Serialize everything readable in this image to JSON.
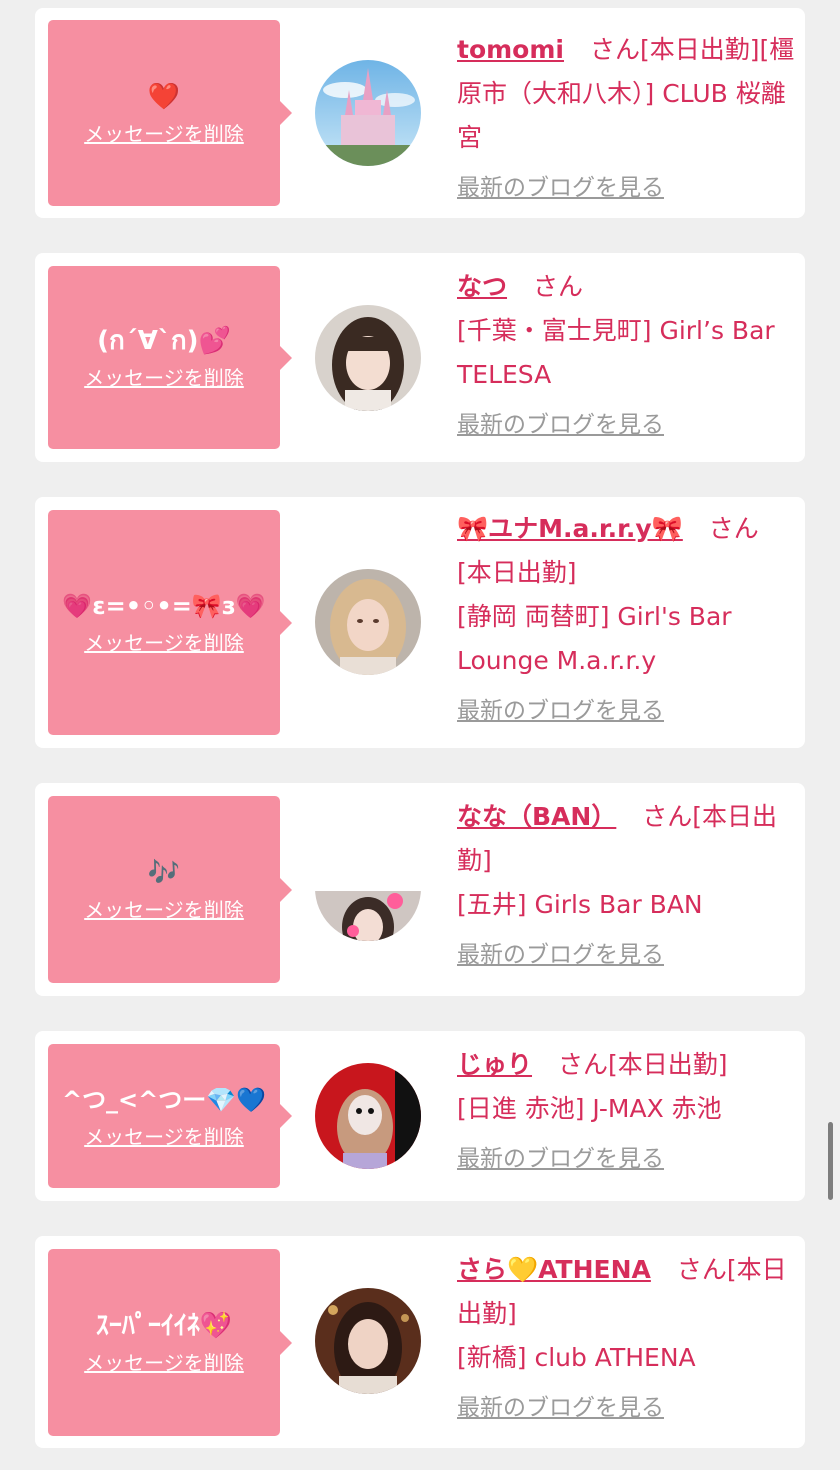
{
  "entries": [
    {
      "message": "❤️",
      "delete_label": "メッセージを削除",
      "name": "tomomi",
      "san": "さん",
      "details": "[本日出勤][橿原市（大和八木）] CLUB 桜離宮",
      "blog_label": "最新のブログを見る",
      "avatar_desc": "castle-photo"
    },
    {
      "message": "(ก´∀`ก)💕",
      "delete_label": "メッセージを削除",
      "name": "なつ",
      "san": "さん",
      "details": "[千葉・富士見町] Girl’s Bar TELESA",
      "blog_label": "最新のブログを見る",
      "avatar_desc": "girl-photo"
    },
    {
      "message": "💗ɛ=•◦•=🎀з💗",
      "delete_label": "メッセージを削除",
      "name": "🎀ユナM.a.r.r.y🎀",
      "san": "さん",
      "details": "[本日出勤]\n[静岡 両替町] Girl's Bar Lounge M.a.r.r.y",
      "blog_label": "最新のブログを見る",
      "avatar_desc": "blonde-girl-photo"
    },
    {
      "message": "🎶",
      "delete_label": "メッセージを削除",
      "name": "なな（BAN）",
      "san": "さん",
      "details": "[本日出勤]\n[五井] Girls Bar BAN",
      "blog_label": "最新のブログを見る",
      "avatar_desc": "girl-photo-cropped"
    },
    {
      "message": "^つ_<^つー💎💙",
      "delete_label": "メッセージを削除",
      "name": "じゅり",
      "san": "さん",
      "details": "[本日出勤]\n[日進 赤池] J-MAX 赤池",
      "blog_label": "最新のブログを見る",
      "avatar_desc": "girl-red-background-photo"
    },
    {
      "message": "ｽｰﾊﾟｰｲｲﾈ💖",
      "delete_label": "メッセージを削除",
      "name": "さら💛ATHENA",
      "san": "さん",
      "details": "[本日出勤]\n[新橋] club ATHENA",
      "blog_label": "最新のブログを見る",
      "avatar_desc": "girl-dark-photo"
    }
  ],
  "colors": {
    "bubble": "#f68fa1",
    "name": "#d62d5b",
    "link_gray": "#9a9a9a",
    "card_bg": "#ffffff",
    "page_bg": "#efefef"
  }
}
